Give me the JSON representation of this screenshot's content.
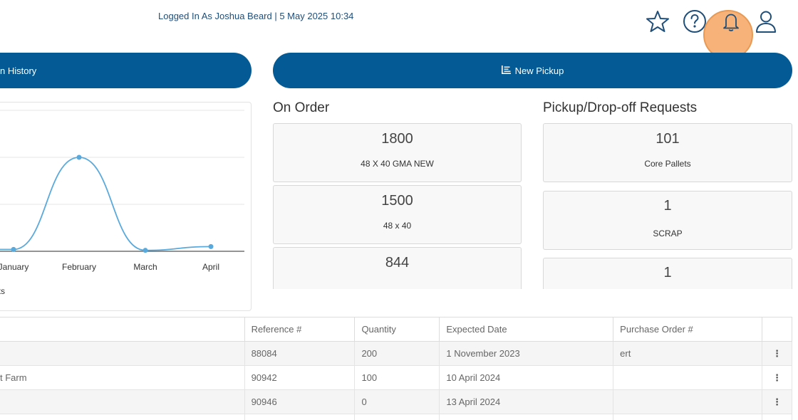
{
  "header": {
    "login_info": "Logged In As Joshua Beard | 5 May 2025 10:34",
    "icons": [
      "star-icon",
      "help-icon",
      "bell-icon",
      "user-icon"
    ]
  },
  "buttons": {
    "history_label": "n History",
    "new_pickup_label": "New Pickup"
  },
  "chart_data": {
    "type": "line",
    "categories": [
      "January",
      "February",
      "March",
      "April"
    ],
    "values": [
      4,
      200,
      2,
      10
    ],
    "ylim": [
      0,
      300
    ],
    "grid": true,
    "legend_text": "ets",
    "line_color": "#5aa9dc"
  },
  "on_order": {
    "title": "On Order",
    "cards": [
      {
        "value": "1800",
        "label": "48 X 40 GMA NEW"
      },
      {
        "value": "1500",
        "label": "48 x 40"
      },
      {
        "value": "844",
        "label": ""
      }
    ]
  },
  "pickup_requests": {
    "title": "Pickup/Drop-off Requests",
    "cards": [
      {
        "value": "101",
        "label": "Core Pallets"
      },
      {
        "value": "1",
        "label": "SCRAP"
      },
      {
        "value": "1",
        "label": ""
      }
    ]
  },
  "table": {
    "headers": [
      "",
      "Reference #",
      "Quantity",
      "Expected Date",
      "Purchase Order #",
      ""
    ],
    "rows": [
      {
        "name": "",
        "reference": "88084",
        "quantity": "200",
        "expected": "1 November 2023",
        "po": "ert",
        "menu": "⋮"
      },
      {
        "name": "t Farm",
        "reference": "90942",
        "quantity": "100",
        "expected": "10 April 2024",
        "po": "",
        "menu": "⋮"
      },
      {
        "name": "",
        "reference": "90946",
        "quantity": "0",
        "expected": "13 April 2024",
        "po": "",
        "menu": "⋮"
      },
      {
        "name": "",
        "reference": "",
        "quantity": "",
        "expected": "",
        "po": "",
        "menu": ""
      }
    ]
  },
  "colors": {
    "primary": "#045a94",
    "header_text": "#1f4e79",
    "highlight": "#f4a460"
  }
}
